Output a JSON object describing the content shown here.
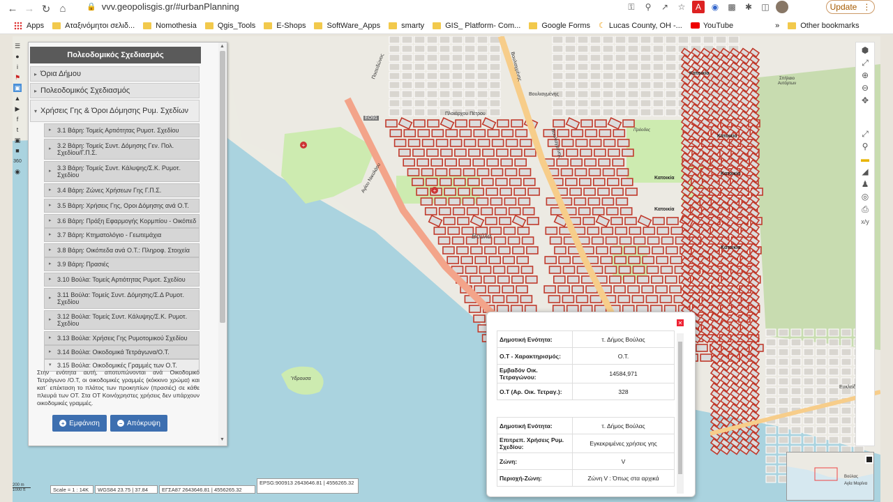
{
  "browser": {
    "url": "vvv.geopolisgis.gr/#urbanPlanning",
    "update_label": "Update"
  },
  "bookmarks": [
    "Apps",
    "Αταξινόμητοι σελιδ...",
    "Nomothesia",
    "Qgis_Tools",
    "E-Shops",
    "SoftWare_Apps",
    "smarty",
    "GIS_ Platform- Com...",
    "Google Forms",
    "Lucas County, OH -...",
    "YouTube",
    "»",
    "Other bookmarks"
  ],
  "left_toolbar": {
    "label_360": "360"
  },
  "panel": {
    "title": "Πολεοδομικός Σχεδιασμός",
    "sections": [
      "Όρια Δήμου",
      "Πολεοδομικός Σχεδιασμός",
      "Χρήσεις Γης & Όροι Δόμησης Ρυμ. Σχεδίων"
    ],
    "subsections": [
      "3.1 Βάρη: Τομείς Αρτιότητας Ρυμοτ. Σχεδίου",
      "3.2 Βάρη: Τομείς Συντ. Δόμησης Γεν. Πολ. Σχεδίου/Γ.Π.Σ.",
      "3.3 Βάρη: Τομείς Συντ. Κάλυψης/Σ.Κ. Ρυμοτ. Σχεδίου",
      "3.4 Βάρη: Ζώνες Χρήσεων Γης Γ.Π.Σ.",
      "3.5 Βάρη: Χρήσεις Γης, Οροι Δόμησης ανά Ο.Τ.",
      "3.6 Βάρη: Πράξη Εφαρμογής Κορμπίου - Οικόπεδ",
      "3.7 Βάρη: Κτηματολόγιο - Γεωτεμάχια",
      "3.8 Βάρη: Οικόπεδα ανά Ο.Τ.: Πληροφ. Στοιχεία",
      "3.9 Βάρη: Πρασιές",
      "3.10 Βούλα: Τομείς Αρτιότητας Ρυμοτ. Σχεδίου",
      "3.11 Βούλα: Τομείς Συντ. Δόμησης/Σ.Δ Ρυμοτ. Σχεδίου",
      "3.12 Βούλα: Τομείς Συντ. Κάλυψης/Σ.Κ. Ρυμοτ. Σχεδίου",
      "3.13 Βούλα: Χρήσεις Γης Ρυμοτομικού Σχεδίου",
      "3.14 Βούλα: Οικοδομικά Τετράγωνα/Ο.Τ.",
      "3.15 Βούλα: Οικοδομικές Γραμμές των Ο.Τ."
    ],
    "description": "Στην ενότητα αυτή, αποτυπώνονται ανά Οικοδομικό Τετράγωνο /Ο.Τ, οι οικοδομικές γραμμές (κόκκινο χρώμα) και κατ΄ επέκταση το πλάτος των προκηπίων (πρασιές) σε κάθε πλευρά των ΟΤ. Στα ΟΤ Κοινόχρηστες χρήσεις δεν υπάρχουν οικοδομικές γραμμές.",
    "show_label": "Εμφάνιση",
    "hide_label": "Απόκρυψη"
  },
  "map_labels": {
    "road_e091": "ΕΟ91",
    "vouliagmenis_label": "Βουλιαγμένης",
    "vouliagmenis_label2": "Βουλιαγμένης",
    "poseidonos": "Ποσειδώνος",
    "agiou_nikolaou": "Αγίου Νικολάου",
    "ploiarchou_petrou": "Πλοιάρχου Πέτρου",
    "vouliagmenis_gr": "Βουλιαγμένης",
    "voula": "Βούλα",
    "ydrousa": "Ύδρουσα",
    "katoikia": "Κατοικία",
    "spilaio": "Σπήλαιο Αυτόρτων",
    "prosodos": "Πρόοδος",
    "euklidou": "Ευκλείδου",
    "agia_marina": "Αγία Μαρίνα",
    "voulas_ov": "Βούλας"
  },
  "popup": {
    "table1": [
      {
        "key": "Δημοτική Ενότητα:",
        "value": "τ. Δήμος Βούλας"
      },
      {
        "key": "Ο.Τ - Χαρακτηρισμός:",
        "value": "Ο.Τ."
      },
      {
        "key": "Εμβαδόν Οικ. Τετραγώνου:",
        "value": "14584,971"
      },
      {
        "key": "Ο.Τ (Αρ. Οικ. Τετραγ.):",
        "value": "328"
      }
    ],
    "table2": [
      {
        "key": "Δημοτική Ενότητα:",
        "value": "τ. Δήμος Βούλας"
      },
      {
        "key": "Επιτρεπ. Χρήσεις Ρυμ. Σχεδίου:",
        "value": "Εγκεκριμένες χρήσεις γης"
      },
      {
        "key": "Ζώνη:",
        "value": "V"
      },
      {
        "key": "Περιοχή-Ζώνη:",
        "value": "Ζώνη V : Όπως στα αρχικά"
      }
    ]
  },
  "status": {
    "scale": "Scale = 1 : 14K",
    "wgs84": "WGS84 23.75 | 37.84",
    "egsa87": "ΕΓΣΑ87 2643646.81 | 4556265.32",
    "epsg": "EPSG:900913 2643646.81 | 4556265.32",
    "scalebar_top": "200 m",
    "scalebar_bottom": "1000 ft"
  },
  "right_toolbar": {
    "xy_label": "x/y"
  }
}
